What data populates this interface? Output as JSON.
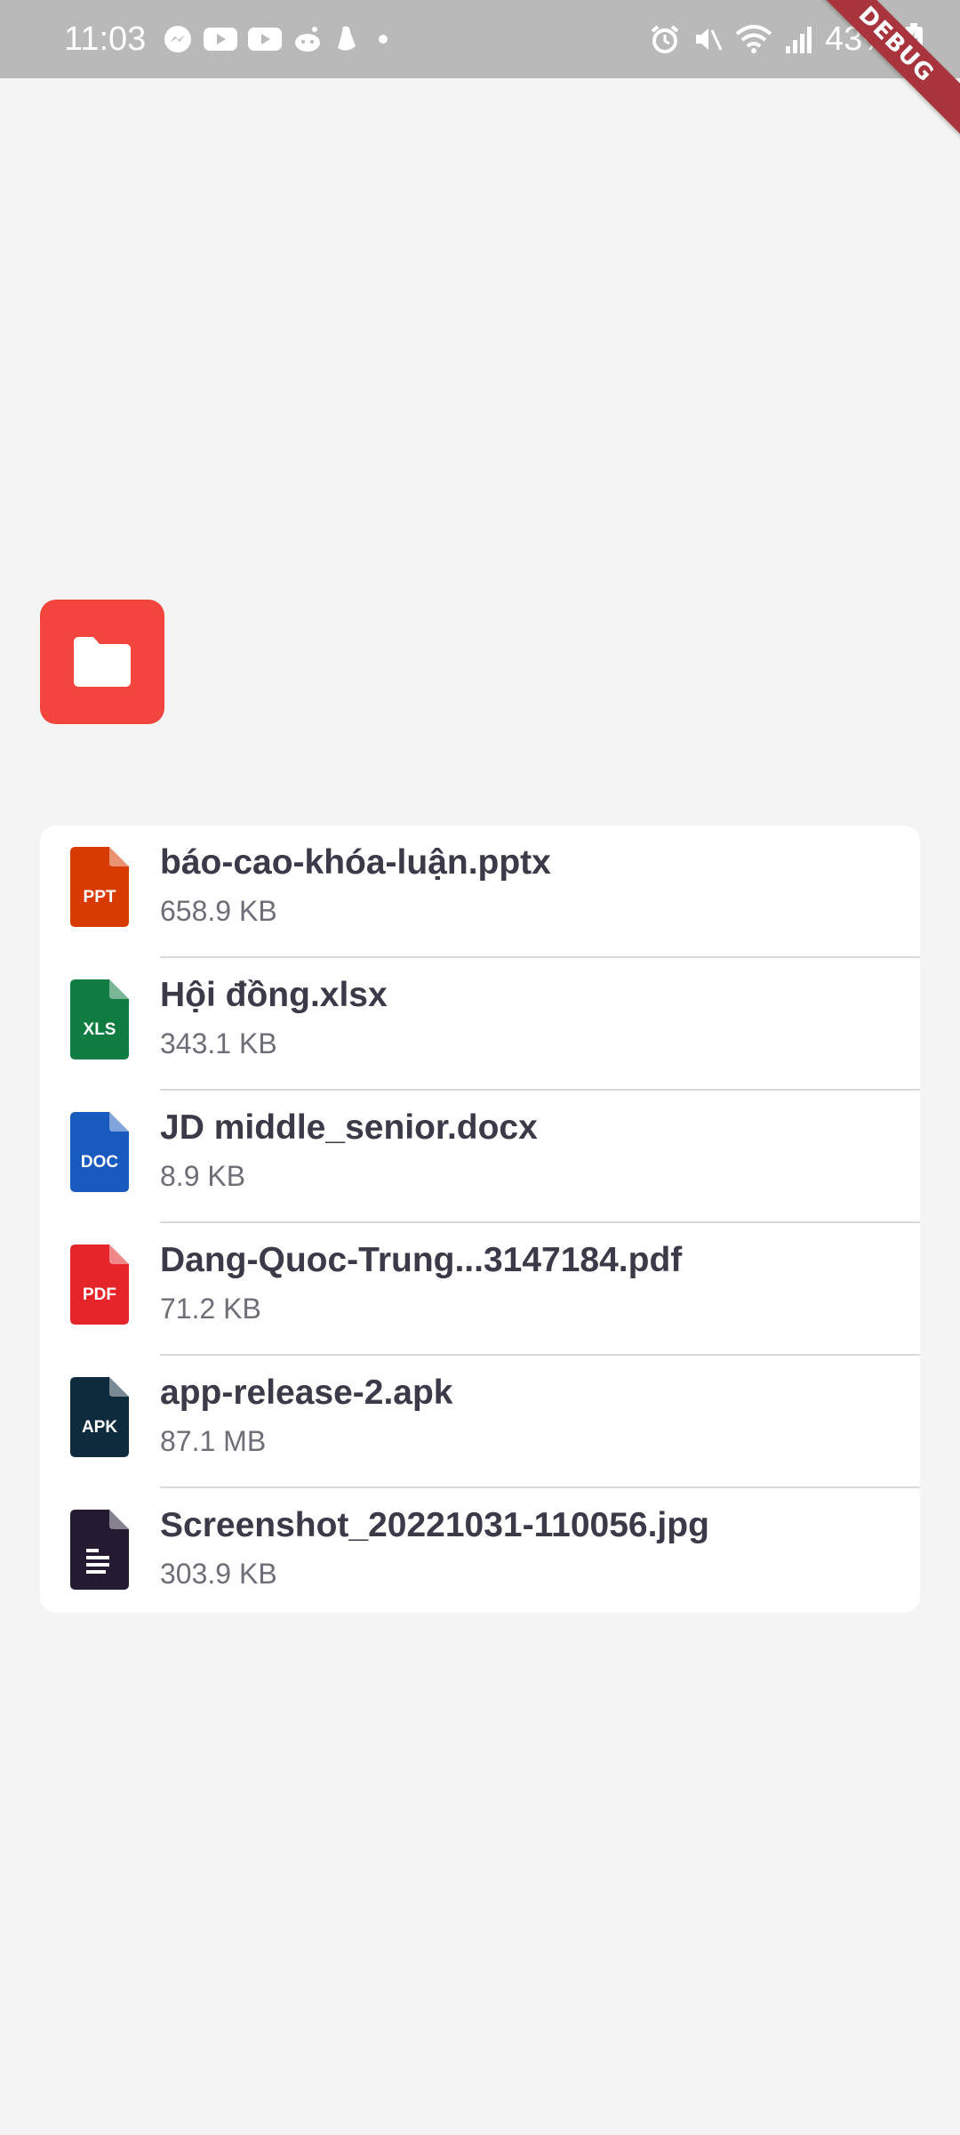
{
  "status_bar": {
    "time": "11:03",
    "left_icons": [
      "messenger-icon",
      "youtube-icon",
      "youtube-icon",
      "reddit-icon",
      "app-icon",
      "dot-icon"
    ],
    "right_icons": [
      "alarm-icon",
      "mute-icon",
      "wifi-icon",
      "signal-icon",
      "battery-charging-icon"
    ],
    "battery": "43%"
  },
  "debug_banner": "DEBUG",
  "folder_button": {
    "icon": "folder-icon",
    "color": "#f2453d"
  },
  "files": [
    {
      "name": "báo-cao-khóa-luận.pptx",
      "size": "658.9 KB",
      "type_label": "PPT",
      "color": "#d83b01"
    },
    {
      "name": "Hội đồng.xlsx",
      "size": "343.1 KB",
      "type_label": "XLS",
      "color": "#107c41"
    },
    {
      "name": "JD middle_senior.docx",
      "size": "8.9 KB",
      "type_label": "DOC",
      "color": "#185abd"
    },
    {
      "name": "Dang-Quoc-Trung...3147184.pdf",
      "size": "71.2 KB",
      "type_label": "PDF",
      "color": "#e5252a"
    },
    {
      "name": "app-release-2.apk",
      "size": "87.1 MB",
      "type_label": "APK",
      "color": "#0e2a3d"
    },
    {
      "name": "Screenshot_20221031-110056.jpg",
      "size": "303.9 KB",
      "type_label": "",
      "color": "#241b33"
    }
  ]
}
